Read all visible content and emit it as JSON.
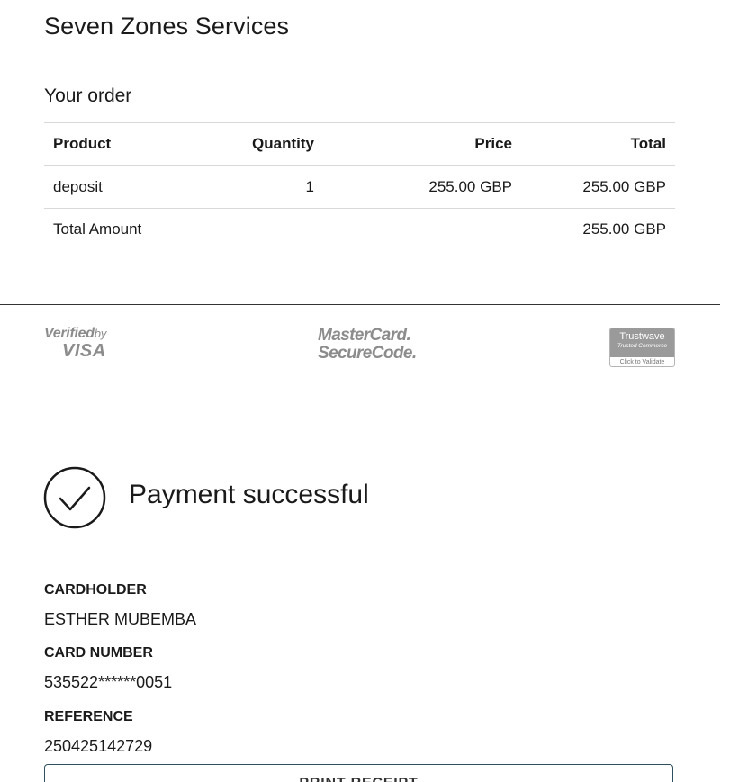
{
  "merchant": {
    "name": "Seven Zones Services"
  },
  "order": {
    "heading": "Your order",
    "columns": [
      "Product",
      "Quantity",
      "Price",
      "Total"
    ],
    "items": [
      {
        "product": "deposit",
        "quantity": "1",
        "price": "255.00 GBP",
        "total": "255.00 GBP"
      }
    ],
    "total_label": "Total Amount",
    "total_value": "255.00 GBP"
  },
  "security_logos": {
    "visa": {
      "line1": "Verified",
      "line1_suffix": "by",
      "line2": "VISA"
    },
    "mastercard": {
      "line1": "MasterCard.",
      "line2": "SecureCode."
    },
    "trustwave": {
      "name": "Trustwave",
      "sub": "Trusted Commerce",
      "footer": "Click to Validate"
    }
  },
  "payment": {
    "status": "Payment successful",
    "cardholder_label": "CARDHOLDER",
    "cardholder_value": "ESTHER MUBEMBA",
    "card_number_label": "CARD NUMBER",
    "card_number_value": "535522******0051",
    "reference_label": "REFERENCE",
    "reference_value": "250425142729",
    "print_button_label": "PRINT RECEIPT"
  }
}
